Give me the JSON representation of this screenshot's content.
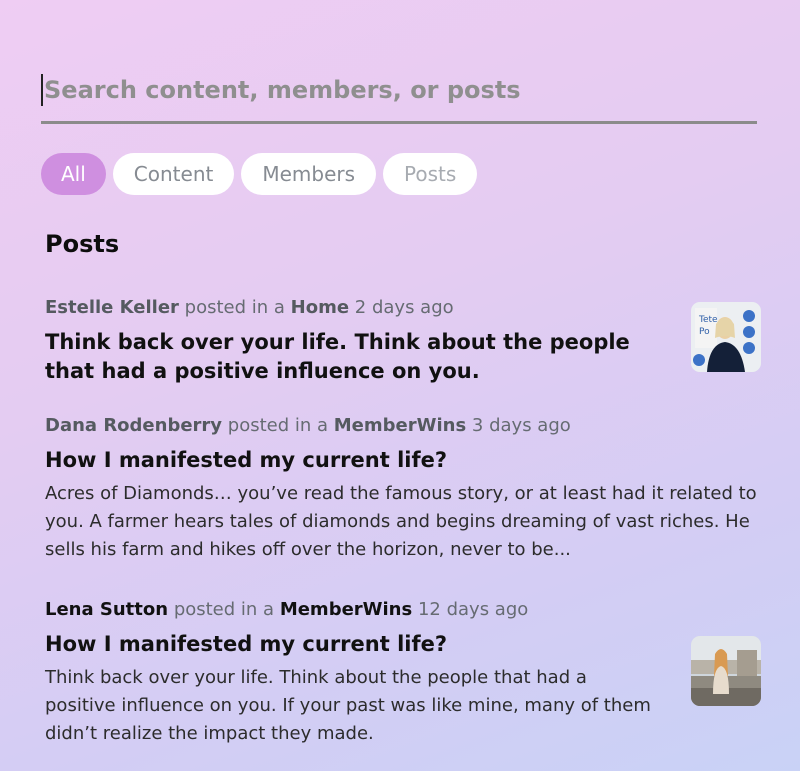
{
  "search": {
    "placeholder": "Search content, members, or posts"
  },
  "filters": [
    {
      "label": "All",
      "active": true
    },
    {
      "label": "Content",
      "active": false
    },
    {
      "label": "Members",
      "active": false
    },
    {
      "label": "Posts",
      "active": false
    }
  ],
  "section": {
    "title": "Posts"
  },
  "posts": [
    {
      "author": "Estelle Keller",
      "posted_in": "posted in a",
      "space": "Home",
      "time": "2 days ago",
      "title": "Think back over your life. Think about the people that had a positive influence on you.",
      "body": "",
      "thumbnail": "person-by-poster-thumbnail"
    },
    {
      "author": "Dana Rodenberry",
      "posted_in": "posted in a",
      "space": "MemberWins",
      "time": "3 days ago",
      "title": "How I manifested my current life?",
      "body": "Acres of Diamonds… you’ve read the famous story, or at least had it related to you. A farmer hears tales of diamonds and begins dreaming of vast riches. He sells his farm and hikes off over the horizon, never to be..."
    },
    {
      "author": "Lena Sutton",
      "posted_in": "posted in a",
      "space": "MemberWins",
      "time": "12 days ago",
      "title": "How I manifested my current life?",
      "body": "Think back over your life. Think about the people that had a positive influence on you. If your past was like mine, many of them didn’t realize the impact they made.",
      "thumbnail": "person-on-rooftop-thumbnail"
    }
  ],
  "colors": {
    "active_chip": "#cf8fe0",
    "chip_bg": "#ffffff",
    "chip_text": "#868b92",
    "meta_text": "#666b72"
  }
}
